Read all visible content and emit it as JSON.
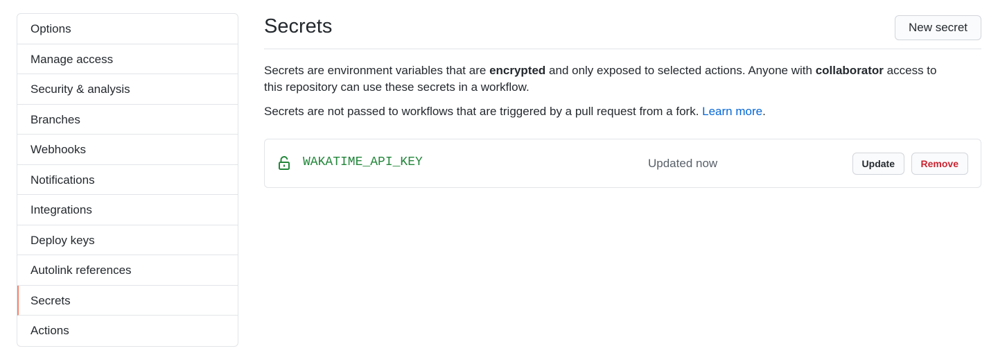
{
  "sidebar": {
    "items": [
      {
        "label": "Options"
      },
      {
        "label": "Manage access"
      },
      {
        "label": "Security & analysis"
      },
      {
        "label": "Branches"
      },
      {
        "label": "Webhooks"
      },
      {
        "label": "Notifications"
      },
      {
        "label": "Integrations"
      },
      {
        "label": "Deploy keys"
      },
      {
        "label": "Autolink references"
      },
      {
        "label": "Secrets",
        "selected": true
      },
      {
        "label": "Actions"
      }
    ]
  },
  "main": {
    "title": "Secrets",
    "new_secret_label": "New secret",
    "description": {
      "p1_a": "Secrets are environment variables that are ",
      "p1_b": "encrypted",
      "p1_c": " and only exposed to selected actions. Anyone with ",
      "p1_d": "collaborator",
      "p1_e": " access to this repository can use these secrets in a workflow.",
      "p2_a": "Secrets are not passed to workflows that are triggered by a pull request from a fork. ",
      "p2_link": "Learn more",
      "p2_end": "."
    },
    "secrets": [
      {
        "name": "WAKATIME_API_KEY",
        "updated": "Updated now",
        "update_label": "Update",
        "remove_label": "Remove"
      }
    ]
  },
  "colors": {
    "selected_accent": "#f9826c",
    "secret_name": "#22863a",
    "link": "#0366d6",
    "danger": "#cb2431"
  },
  "icons": {
    "secret_lock": "unlock-icon"
  }
}
